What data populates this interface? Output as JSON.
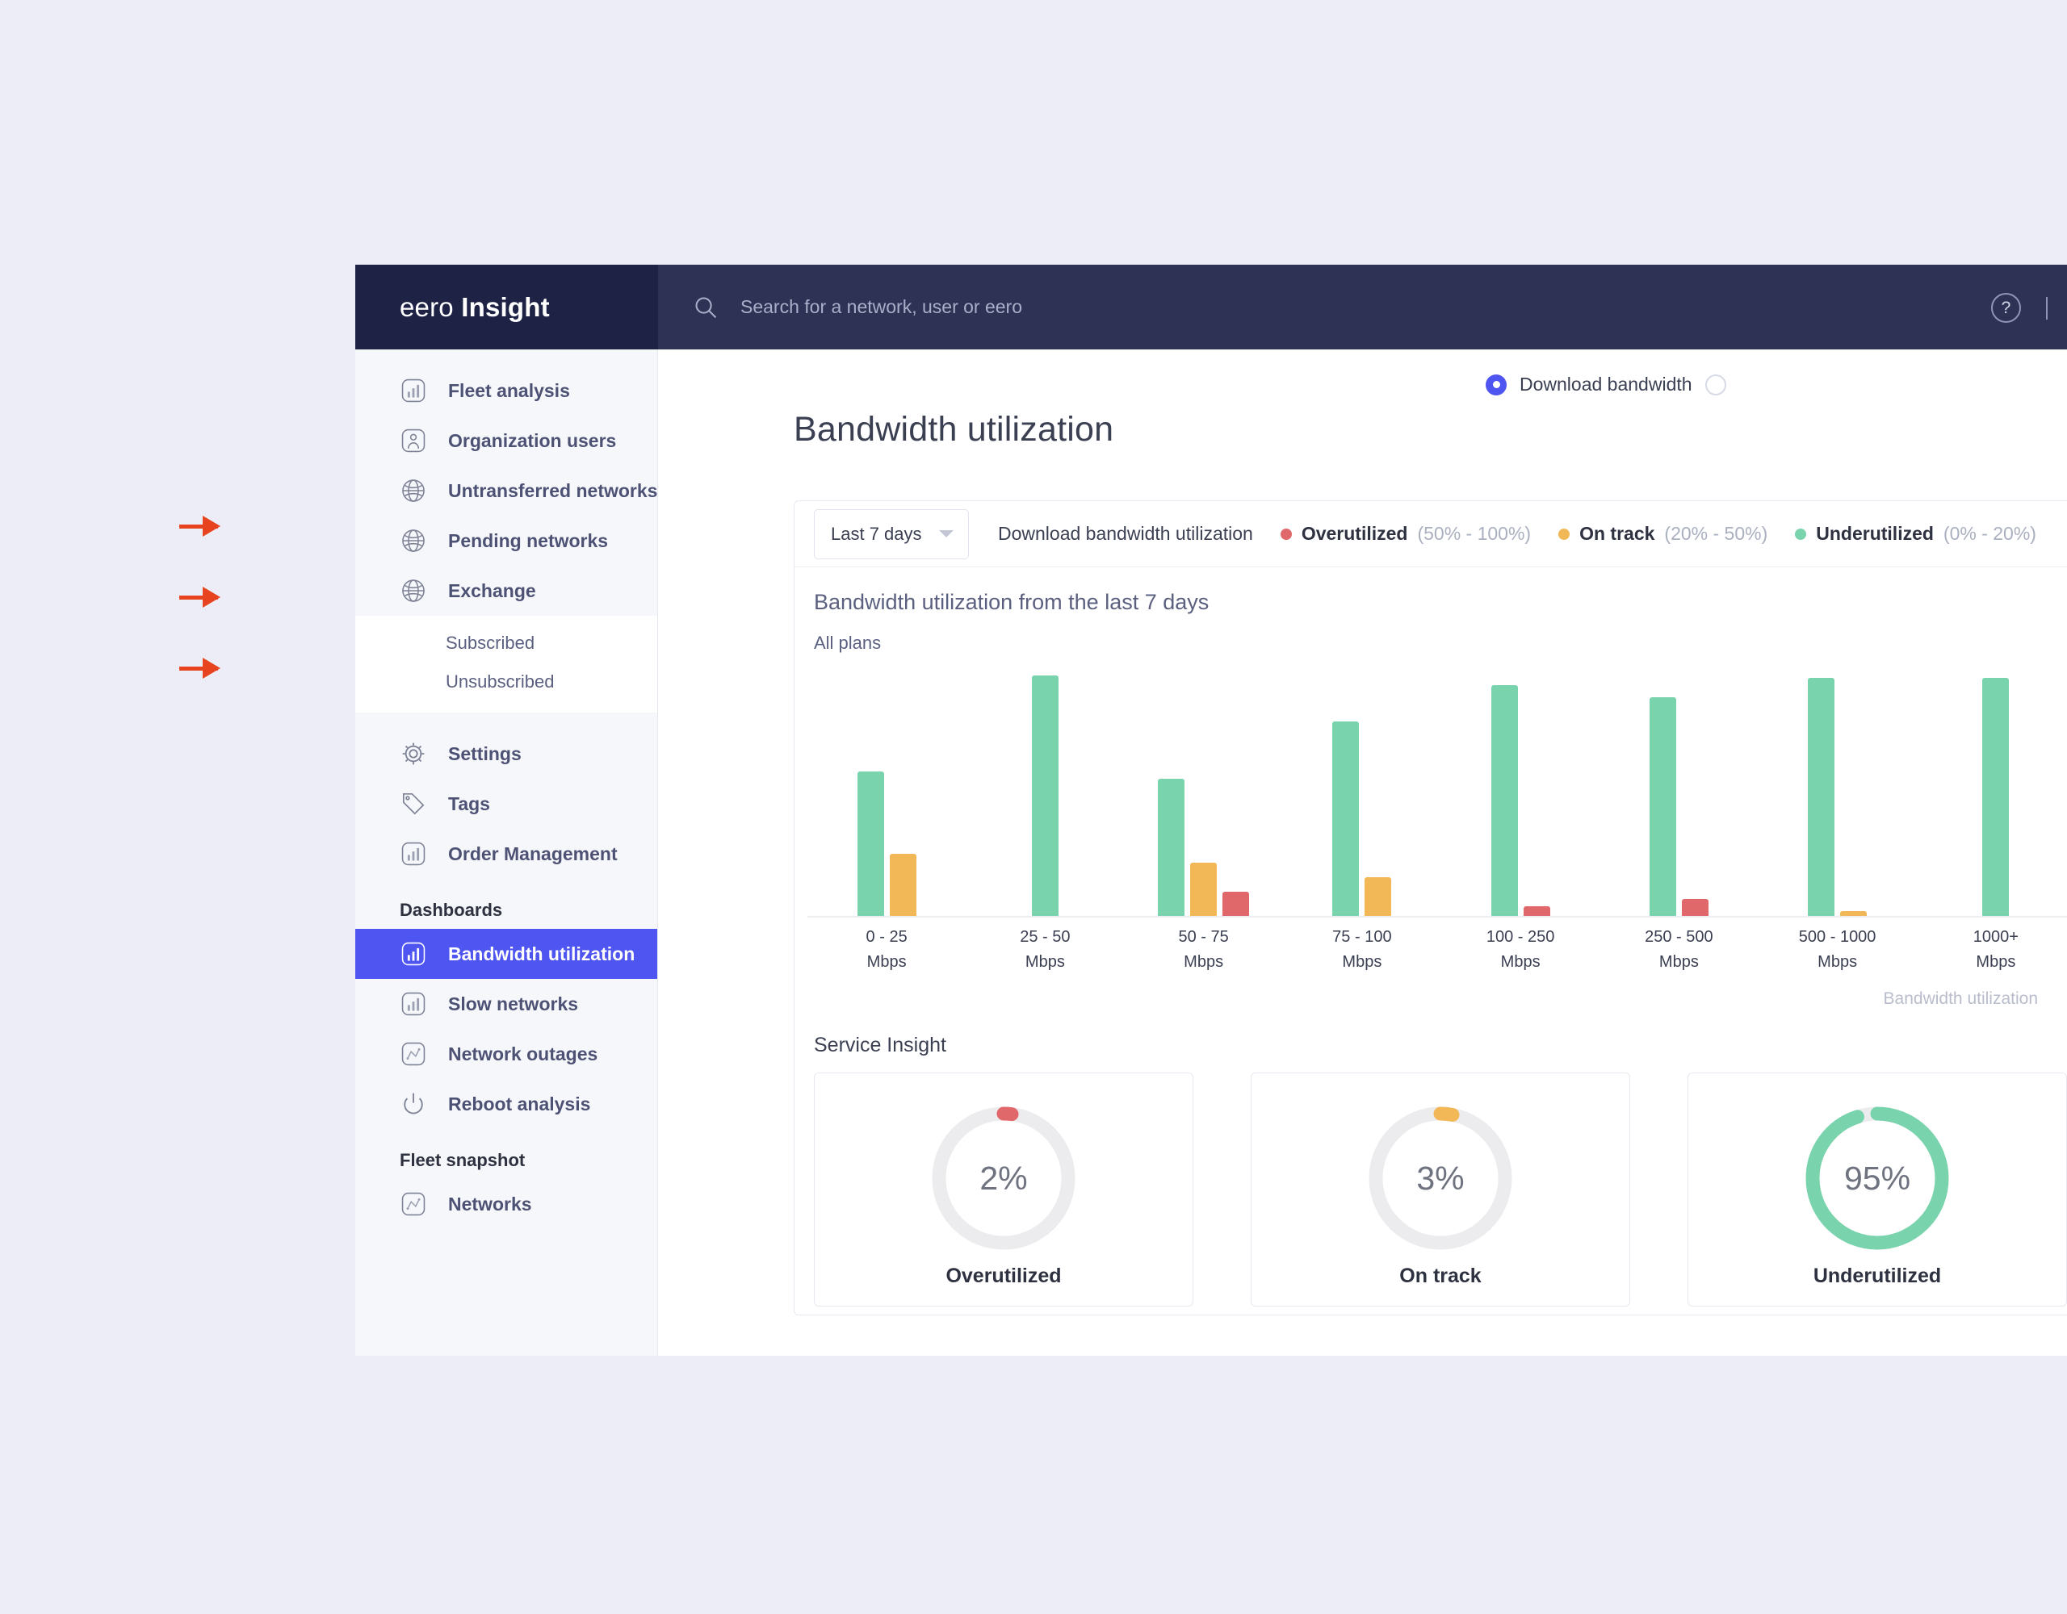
{
  "brand": {
    "light": "eero",
    "bold": "Insight"
  },
  "search": {
    "placeholder": "Search for a network, user or eero",
    "value": "",
    "icon": "search-icon"
  },
  "topbar": {
    "help_label": "?"
  },
  "sidebar": {
    "items": [
      {
        "label": "Fleet analysis",
        "icon": "bar-chart-icon"
      },
      {
        "label": "Organization users",
        "icon": "user-icon"
      },
      {
        "label": "Untransferred networks",
        "icon": "globe-icon"
      },
      {
        "label": "Pending networks",
        "icon": "globe-icon"
      },
      {
        "label": "Exchange",
        "icon": "globe-icon"
      }
    ],
    "subitems": [
      {
        "label": "Subscribed"
      },
      {
        "label": "Unsubscribed"
      }
    ],
    "tools": [
      {
        "label": "Settings",
        "icon": "gear-icon"
      },
      {
        "label": "Tags",
        "icon": "tag-icon"
      },
      {
        "label": "Order Management",
        "icon": "bar-chart-icon"
      }
    ],
    "dashboards_heading": "Dashboards",
    "dashboards": [
      {
        "label": "Bandwidth utilization",
        "icon": "bar-chart-icon",
        "active": true
      },
      {
        "label": "Slow networks",
        "icon": "bar-chart-icon",
        "active": false
      },
      {
        "label": "Network outages",
        "icon": "line-chart-icon",
        "active": false
      },
      {
        "label": "Reboot analysis",
        "icon": "power-icon",
        "active": false
      }
    ],
    "snapshot_heading": "Fleet snapshot",
    "snapshot": [
      {
        "label": "Networks",
        "icon": "line-chart-icon"
      }
    ],
    "active_color": "#4e55f0"
  },
  "main": {
    "page_title": "Bandwidth utilization",
    "bandwidth_toggle": {
      "selected_label": "Download bandwidth",
      "selected_color": "#4e55f0"
    },
    "range_select": {
      "value": "Last 7 days"
    },
    "card_title": "Bandwidth utilization from the last 7 days",
    "card_subtitle": "All plans",
    "service_insight_heading": "Service Insight",
    "axis_caption": "Bandwidth utilization"
  },
  "chart_data": {
    "type": "bar",
    "title": "Download bandwidth utilization",
    "xlabel": "Bandwidth utilization",
    "ylabel": "",
    "grid": false,
    "legend_position": "top",
    "categories": [
      "0 - 25\nMbps",
      "25 - 50\nMbps",
      "50 - 75\nMbps",
      "75 - 100\nMbps",
      "100 - 250\nMbps",
      "250 - 500\nMbps",
      "500 - 1000\nMbps",
      "1000+\nMbps"
    ],
    "category_lines": [
      [
        "0 - 25",
        "Mbps"
      ],
      [
        "25 - 50",
        "Mbps"
      ],
      [
        "50 - 75",
        "Mbps"
      ],
      [
        "75 - 100",
        "Mbps"
      ],
      [
        "100 - 250",
        "Mbps"
      ],
      [
        "250 - 500",
        "Mbps"
      ],
      [
        "500 - 1000",
        "Mbps"
      ],
      [
        "1000+",
        "Mbps"
      ]
    ],
    "series": [
      {
        "name": "Underutilized",
        "color": "#79d4ad",
        "values": [
          60,
          100,
          57,
          81,
          96,
          91,
          99,
          99
        ]
      },
      {
        "name": "On track",
        "color": "#f2b857",
        "values": [
          26,
          0,
          22,
          16,
          0,
          0,
          2,
          0
        ]
      },
      {
        "name": "Overutilized",
        "color": "#e0686a",
        "values": [
          0,
          0,
          10,
          0,
          4,
          7,
          0,
          0
        ]
      }
    ],
    "ylim": [
      0,
      100
    ],
    "legend": [
      {
        "name": "Overutilized",
        "range": "(50% - 100%)",
        "color": "#e0686a"
      },
      {
        "name": "On track",
        "range": "(20% - 50%)",
        "color": "#f2b857"
      },
      {
        "name": "Underutilized",
        "range": "(0% - 20%)",
        "color": "#79d4ad"
      }
    ]
  },
  "service_insight": {
    "cards": [
      {
        "value": "2%",
        "label": "Overutilized",
        "percent": 2,
        "color": "#e0686a"
      },
      {
        "value": "3%",
        "label": "On track",
        "percent": 3,
        "color": "#f2b857"
      },
      {
        "value": "95%",
        "label": "Underutilized",
        "percent": 95,
        "color": "#79d4ad"
      }
    ],
    "track_color": "#ececee"
  }
}
